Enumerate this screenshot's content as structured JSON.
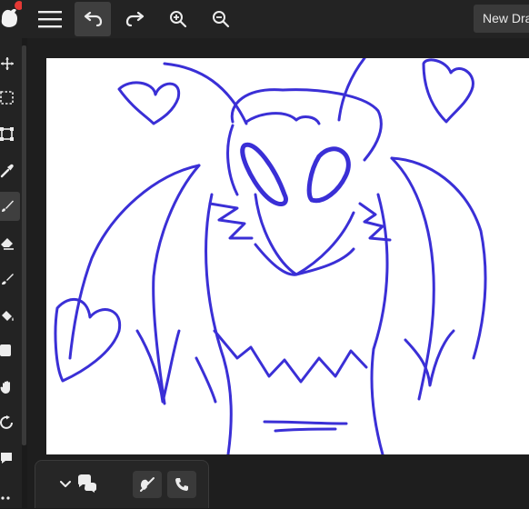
{
  "app": {
    "new_drawing_label": "New Drawing",
    "accent_color": "#e53935",
    "stroke_color": "#3a2fd6"
  },
  "topbar": {
    "buttons": [
      {
        "name": "menu",
        "icon": "hamburger-icon"
      },
      {
        "name": "undo",
        "icon": "undo-icon"
      },
      {
        "name": "redo",
        "icon": "redo-icon"
      },
      {
        "name": "zoom-in",
        "icon": "zoom-in-icon"
      },
      {
        "name": "zoom-out",
        "icon": "zoom-out-icon"
      }
    ]
  },
  "tools": [
    {
      "name": "move",
      "icon": "move-icon"
    },
    {
      "name": "select",
      "icon": "marquee-select-icon"
    },
    {
      "name": "transform",
      "icon": "transform-icon"
    },
    {
      "name": "eyedropper",
      "icon": "eyedropper-icon"
    },
    {
      "name": "brush",
      "icon": "brush-icon",
      "active": true
    },
    {
      "name": "eraser",
      "icon": "eraser-icon"
    },
    {
      "name": "smudge",
      "icon": "smudge-brush-icon"
    },
    {
      "name": "fill",
      "icon": "paint-bucket-icon"
    },
    {
      "name": "shape",
      "icon": "rectangle-icon"
    },
    {
      "name": "hand",
      "icon": "hand-icon"
    },
    {
      "name": "rotate",
      "icon": "rotate-icon"
    },
    {
      "name": "comment",
      "icon": "speech-bubble-icon"
    },
    {
      "name": "more",
      "icon": "more-icon"
    }
  ],
  "bottom_panel": {
    "buttons": [
      {
        "name": "collapse",
        "icon": "chevron-down-icon"
      },
      {
        "name": "chat",
        "icon": "chat-bubbles-icon"
      },
      {
        "name": "voice-off",
        "icon": "voice-off-icon"
      },
      {
        "name": "call",
        "icon": "phone-icon"
      }
    ]
  }
}
